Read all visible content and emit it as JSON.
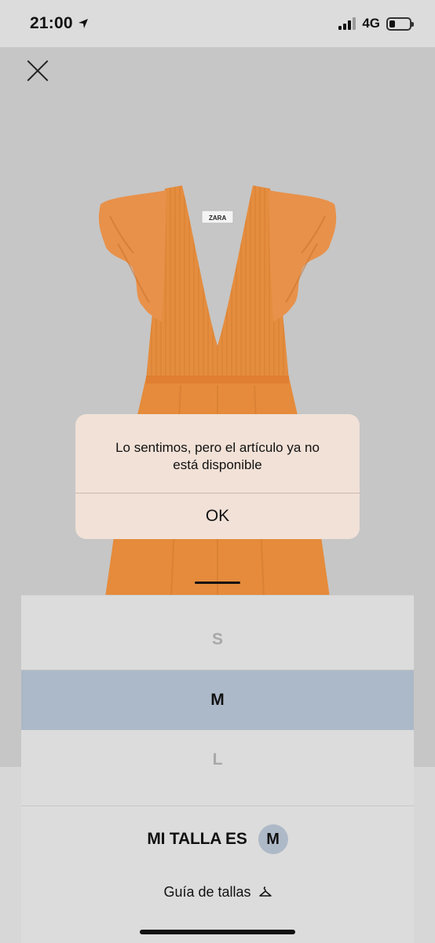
{
  "status_bar": {
    "time": "21:00",
    "network": "4G",
    "icons": [
      "location-arrow-icon",
      "signal-icon",
      "battery-icon"
    ]
  },
  "product": {
    "close_icon": "close-icon",
    "brand_tag": "ZARA",
    "image_indicator": "slide-indicator"
  },
  "dialog": {
    "message": "Lo sentimos, pero el artículo ya no está disponible",
    "ok_label": "OK"
  },
  "size_selector": {
    "sizes": [
      {
        "label": "S",
        "state": "unavailable"
      },
      {
        "label": "M",
        "state": "selected"
      },
      {
        "label": "L",
        "state": "unavailable"
      }
    ],
    "my_size_label": "MI TALLA ES",
    "my_size_value": "M",
    "size_guide_label": "Guía de tallas",
    "size_guide_icon": "hanger-icon"
  },
  "colors": {
    "dress": "#e38a3c",
    "dialog_bg": "#f1e1d7",
    "selected_size_bg": "#acb9c8"
  }
}
